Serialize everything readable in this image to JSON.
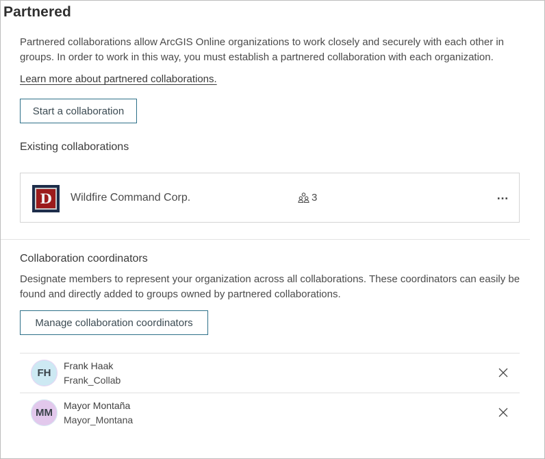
{
  "page": {
    "title": "Partnered",
    "intro": "Partnered collaborations allow ArcGIS Online organizations to work closely and securely with each other in groups. In order to work in this way, you must establish a partnered collaboration with each organization.",
    "learn_more_link": "Learn more about partnered collaborations.",
    "start_button": "Start a collaboration"
  },
  "existing": {
    "heading": "Existing collaborations",
    "collaborations": [
      {
        "name": "Wildfire Command Corp.",
        "logo_text": "D",
        "member_count": "3",
        "more_label": "…",
        "icon": "group-icon"
      }
    ]
  },
  "coordinators": {
    "heading": "Collaboration coordinators",
    "description": "Designate members to represent your organization across all collaborations. These coordinators can easily be found and directly added to groups owned by partnered collaborations.",
    "manage_button": "Manage collaboration coordinators",
    "list": [
      {
        "initials": "FH",
        "name": "Frank Haak",
        "username": "Frank_Collab",
        "remove_icon": "close-icon"
      },
      {
        "initials": "MM",
        "name": "Mayor Montaña",
        "username": "Mayor_Montana",
        "remove_icon": "close-icon"
      }
    ]
  },
  "colors": {
    "button_border": "#2c6f88",
    "logo_red": "#9c1b1b",
    "logo_navy": "#1d2d4a",
    "avatar_fh": "#cde9f3",
    "avatar_mm": "#e2c8ec"
  }
}
